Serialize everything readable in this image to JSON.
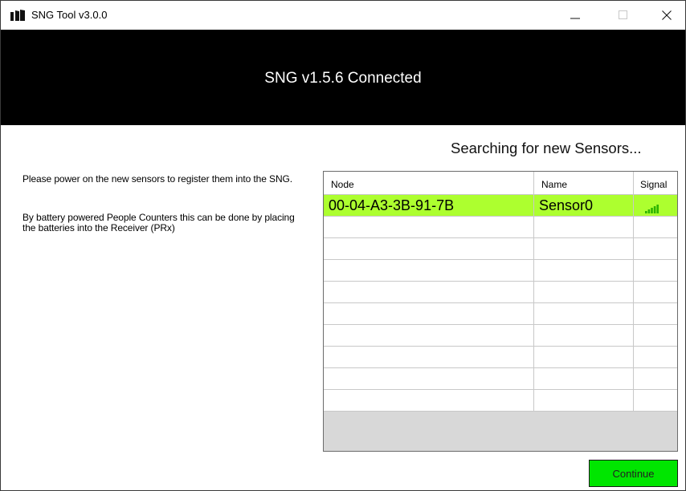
{
  "window": {
    "title": "SNG Tool v3.0.0"
  },
  "banner": {
    "text": "SNG v1.5.6 Connected"
  },
  "status": {
    "text": "Searching for new Sensors..."
  },
  "instructions": {
    "line1": "Please power on the new sensors to register them into the SNG.",
    "line2": "By battery powered People Counters this can be done by placing the batteries into the Receiver (PRx)"
  },
  "sensor_table": {
    "columns": [
      "Node",
      "Name",
      "Signal"
    ],
    "rows": [
      {
        "node": "00-04-A3-3B-91-7B",
        "name": "Sensor0",
        "signal_bars": 5,
        "signal_icon": "signal-strength-icon"
      }
    ],
    "empty_row_count": 9,
    "selected_row_color": "#adff2f"
  },
  "actions": {
    "continue_label": "Continue",
    "continue_color": "#00e600"
  }
}
